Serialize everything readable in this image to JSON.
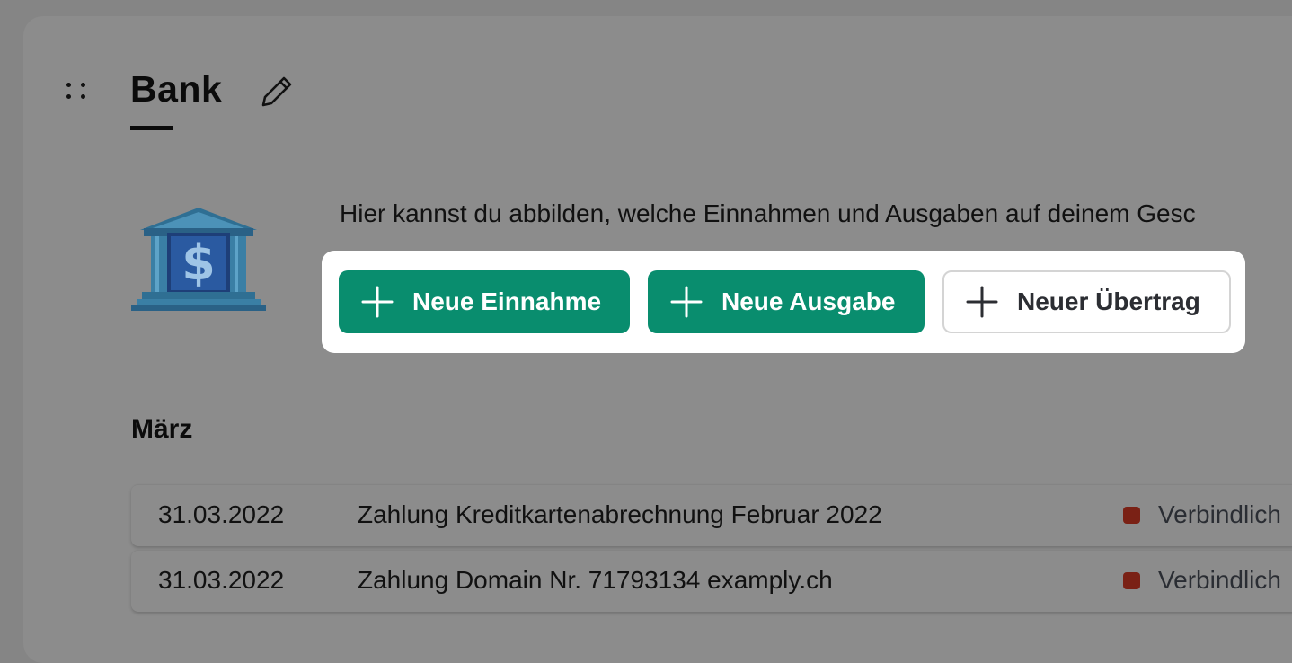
{
  "header": {
    "title": "Bank",
    "icons": {
      "drag": "drag-handle-icon",
      "edit": "pencil-icon"
    }
  },
  "intro": {
    "text": "Hier kannst du abbilden, welche Einnahmen und Ausgaben auf deinem Gesc",
    "illustration": "bank-building-dollar-icon"
  },
  "actions": {
    "new_income": "Neue Einnahme",
    "new_expense": "Neue Ausgabe",
    "new_transfer": "Neuer Übertrag",
    "icon": "plus-icon"
  },
  "month": "März",
  "transactions": [
    {
      "date": "31.03.2022",
      "description": "Zahlung Kreditkartenabrechnung Februar 2022",
      "status": "Verbindlich"
    },
    {
      "date": "31.03.2022",
      "description": "Zahlung Domain Nr. 71793134 examply.ch",
      "status": "Verbindlich"
    }
  ],
  "colors": {
    "accent_green": "#098d6e",
    "status_dot": "#7a2115",
    "overlay_bg": "#8c8c8c"
  }
}
